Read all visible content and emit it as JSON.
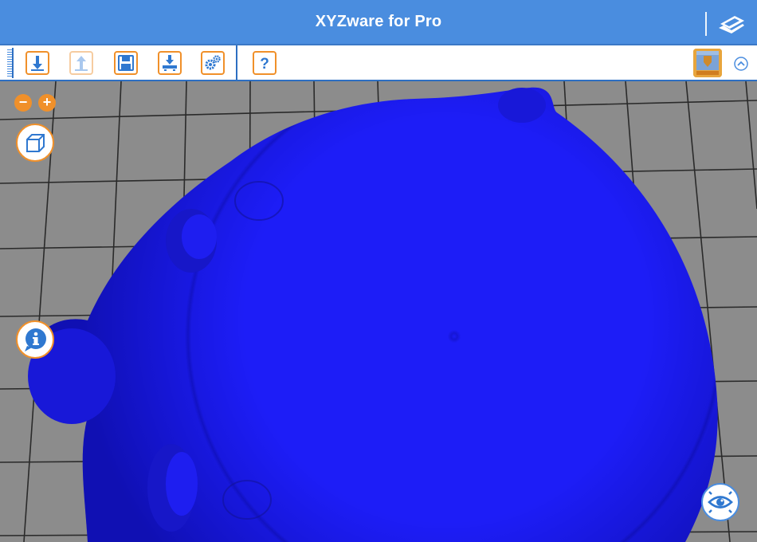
{
  "app": {
    "title": "XYZware for Pro"
  },
  "toolbar": {
    "buttons": [
      {
        "name": "import-button",
        "icon": "download-arrow-icon",
        "enabled": true
      },
      {
        "name": "export-button",
        "icon": "upload-arrow-icon",
        "enabled": false
      },
      {
        "name": "save-button",
        "icon": "floppy-disk-icon",
        "enabled": true
      },
      {
        "name": "print-button",
        "icon": "print-to-printer-icon",
        "enabled": true
      },
      {
        "name": "settings-button",
        "icon": "gears-icon",
        "enabled": true
      },
      {
        "name": "help-button",
        "icon": "question-mark-icon",
        "enabled": true
      }
    ],
    "printer_icon": "printer-icon",
    "collapse_icon": "chevron-up-circle-icon"
  },
  "viewport": {
    "zoom_out_label": "−",
    "zoom_in_label": "+",
    "view_cube_icon": "cube-icon",
    "info_icon": "info-bubble-icon",
    "visibility_icon": "eye-icon",
    "model_color": "#1a1aff",
    "bed_color": "#8c8c8c",
    "grid_color": "#2a2a2a"
  },
  "colors": {
    "accent": "#4a8ddf",
    "button_border": "#f0902a"
  }
}
